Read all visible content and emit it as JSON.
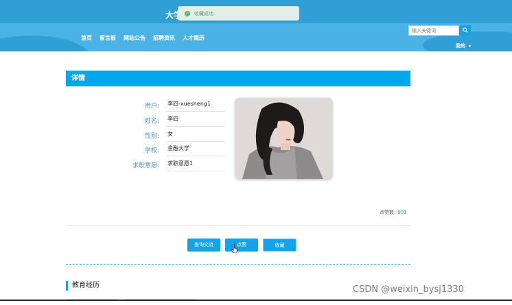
{
  "header": {
    "site_title": "大学",
    "toast_message": "收藏成功",
    "nav": [
      "首页",
      "留言板",
      "网站公告",
      "招聘资讯",
      "人才简历"
    ],
    "search_placeholder": "输入关键词",
    "user_menu": "我的"
  },
  "detail": {
    "title": "详情",
    "fields": [
      {
        "label": "用户:",
        "value": "李四-xuesheng1"
      },
      {
        "label": "姓名:",
        "value": "李四"
      },
      {
        "label": "性别:",
        "value": "女"
      },
      {
        "label": "学校:",
        "value": "金融大学"
      },
      {
        "label": "求职意愿:",
        "value": "求职意愿1"
      }
    ],
    "likes_label": "点赞数:",
    "likes_count": "801",
    "buttons": {
      "chat": "查询交流",
      "like": "点赞",
      "favorite": "收藏"
    }
  },
  "section": {
    "education_title": "教育经历"
  },
  "watermark": "CSDN @weixin_bysj1330",
  "colors": {
    "primary": "#04a7ee",
    "header": "#2f9fd6",
    "label": "#4a8cc8"
  }
}
